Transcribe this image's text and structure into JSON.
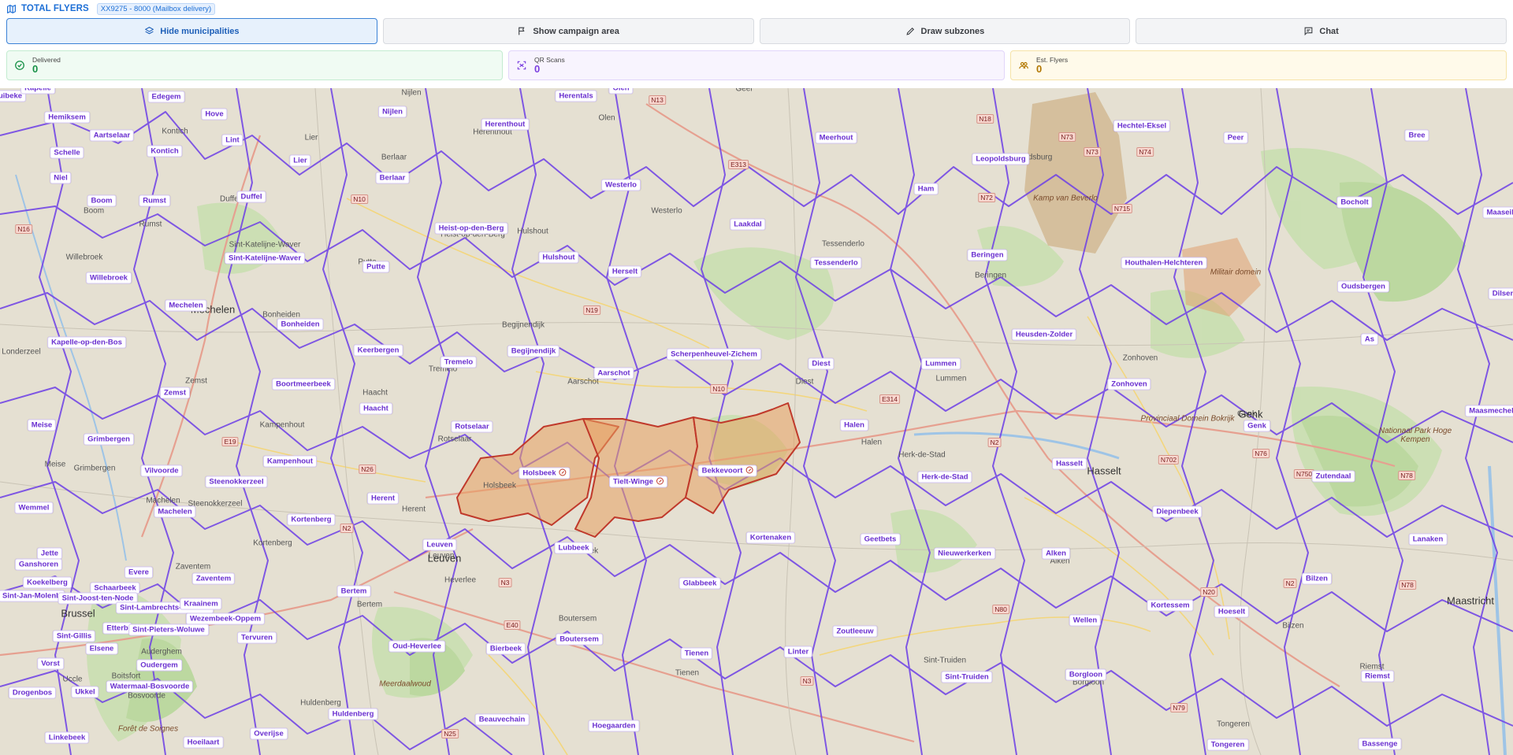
{
  "header": {
    "title": "TOTAL FLYERS",
    "badge": "XX9275 - 8000 (Mailbox delivery)"
  },
  "toolbar": {
    "hide_municipalities": "Hide municipalities",
    "show_campaign_area": "Show campaign area",
    "draw_subzones": "Draw subzones",
    "chat": "Chat"
  },
  "stats": {
    "delivered": {
      "label": "Delivered",
      "value": "0"
    },
    "qr_scans": {
      "label": "QR Scans",
      "value": "0"
    },
    "est_flyers": {
      "label": "Est. Flyers",
      "value": "0"
    }
  },
  "colors": {
    "accent": "#1d6fd6",
    "boundary": "#6d3fe6",
    "selected_fill": "#e8a060",
    "selected_border": "#c0392b"
  },
  "map": {
    "selected": [
      "Holsbeek",
      "Tielt-Winge",
      "Bekkevoort"
    ],
    "municipalities": [
      "uibeke",
      "Edegem",
      "Hemiksem",
      "Hove",
      "Aartselaar",
      "Lint",
      "Schelle",
      "Kontich",
      "Niel",
      "Boom",
      "Rumst",
      "Duffel",
      "Willebroek",
      "Sint-Katelijne-Waver",
      "Mechelen",
      "Bonheiden",
      "Kapelle-op-den-Bos",
      "Zemst",
      "Meise",
      "Grimbergen",
      "Vilvoorde",
      "Steenokkerzeel",
      "Machelen",
      "Wemmel",
      "Jette",
      "Ganshoren",
      "Evere",
      "Koekelberg",
      "Schaarbeek",
      "Zaventem",
      "Sint-Jan-Molenb",
      "Sint-Joost-ten-Node",
      "Sint-Lambrechts-Woluwe",
      "Kraainem",
      "Etterb",
      "Wezembeek-Oppem",
      "Sint-Pieters-Woluwe",
      "Sint-Gillis",
      "Elsene",
      "Tervuren",
      "Oudergem",
      "Vorst",
      "Ukkel",
      "Watermaal-Bosvoorde",
      "Drogenbos",
      "Linkebeek",
      "Hoeilaart",
      "Overijse",
      "Huldenberg",
      "Oud-Heverlee",
      "Bertem",
      "Bierbeek",
      "Beauvechain",
      "Hoegaarden",
      "Boutersem",
      "Tienen",
      "Glabbeek",
      "Linter",
      "Zoutleeuw",
      "Kortenaken",
      "Lubbeek",
      "Leuven",
      "Herent",
      "Kortenberg",
      "Kampenhout",
      "Haacht",
      "Boortmeerbeek",
      "Keerbergen",
      "Tremelo",
      "Rotselaar",
      "Begijnendijk",
      "Aarschot",
      "Scherpenheuvel-Zichem",
      "Diest",
      "Halen",
      "Herk-de-Stad",
      "Geetbets",
      "Nieuwerkerken",
      "Alken",
      "Wellen",
      "Sint-Truiden",
      "Borgloon",
      "Kortessem",
      "Hoeselt",
      "Bilzen",
      "Riemst",
      "Tongeren",
      "Bassenge",
      "Lanaken",
      "Zutendaal",
      "Genk",
      "Diepenbeek",
      "Hasselt",
      "Lummen",
      "Heusden-Zolder",
      "Zonhoven",
      "Houthalen-Helchteren",
      "Oudsbergen",
      "As",
      "Bocholt",
      "Bree",
      "Peer",
      "Hechtel-Eksel",
      "Leopoldsburg",
      "Beringen",
      "Ham",
      "Tessenderlo",
      "Laakdal",
      "Meerhout",
      "Westerlo",
      "Herselt",
      "Hulshout",
      "Heist-op-den-Berg",
      "Herenthout",
      "Herentals",
      "Olen",
      "Nijlen",
      "Berlaar",
      "Lier",
      "Putte",
      "Kapelle",
      "Dilsen",
      "Maasmechelen",
      "Maaseik",
      "Sint-Pieters-Woluwe"
    ],
    "towns": [
      "Nijlen",
      "Olen",
      "Geel",
      "Herenthout",
      "Berlaar",
      "Lier",
      "Westerlo",
      "Tessenderlo",
      "Beringen",
      "Leopoldsburg",
      "Heist-op-den-Berg",
      "Hulshout",
      "Putte",
      "Bonheiden",
      "Haacht",
      "Tremelo",
      "Begijnendijk",
      "Aarschot",
      "Rotselaar",
      "Kampenhout",
      "Holsbeek",
      "Herent",
      "Leuven",
      "Heverlee",
      "Bertem",
      "Boutersem",
      "Tienen",
      "Lubbeek",
      "Diest",
      "Halen",
      "Herk-de-Stad",
      "Lummen",
      "Zonhoven",
      "Hasselt",
      "Genk",
      "Alken",
      "Bilzen",
      "Tongeren",
      "Riemst",
      "Kortenberg",
      "Zaventem",
      "Steenokkerzeel",
      "Grimbergen",
      "Meise",
      "Zemst",
      "Willebroek",
      "Boom",
      "Rumst",
      "Kontich",
      "Duffel",
      "Sint-Katelijne-Waver",
      "Londerzeel",
      "Machelen",
      "Auderghem",
      "Boitsfort",
      "Uccle",
      "Huldenberg",
      "Sint-Truiden",
      "Borgloon",
      "Bosvoorde"
    ],
    "cities": [
      "Mechelen",
      "Brussel",
      "Leuven",
      "Hasselt",
      "Maastricht",
      "Genk"
    ],
    "roads": [
      "N13",
      "E313",
      "N18",
      "N73",
      "N74",
      "N72",
      "N715",
      "N10",
      "N19",
      "N10",
      "E314",
      "N2",
      "N702",
      "N76",
      "N750",
      "N78",
      "N26",
      "N2",
      "E19",
      "N3",
      "E40",
      "N80",
      "N20",
      "N2",
      "N78",
      "N3",
      "N79",
      "N25",
      "N73",
      "N16"
    ],
    "areas": [
      "Kamp van Beverlo",
      "Militair domein",
      "Nationaal Park Hoge Kempen",
      "Provinciaal Domein Bokrijk",
      "Meerdaalwoud",
      "Forêt de Soignes"
    ]
  }
}
